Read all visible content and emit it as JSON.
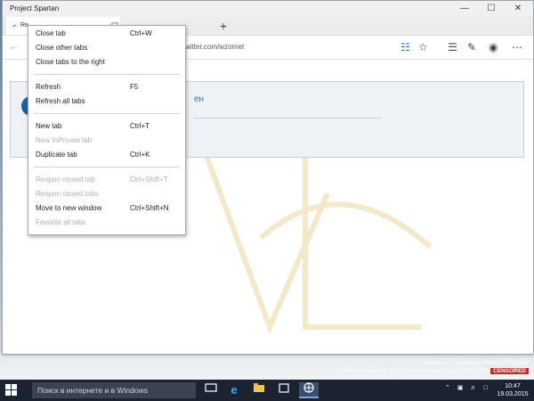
{
  "window": {
    "title": "Project Spartan"
  },
  "tabs": [
    {
      "label": "Re",
      "active": true
    },
    {
      "label": "",
      "active": false
    }
  ],
  "address": {
    "url": "witter.com/wzornet"
  },
  "page": {
    "card_text": "ен"
  },
  "context_menu": {
    "items": [
      {
        "label": "Close tab",
        "shortcut": "Ctrl+W",
        "enabled": true
      },
      {
        "label": "Close other tabs",
        "shortcut": "",
        "enabled": true
      },
      {
        "label": "Close tabs to the right",
        "shortcut": "",
        "enabled": true
      },
      {
        "label": "Refresh",
        "shortcut": "F5",
        "enabled": true
      },
      {
        "label": "Refresh all tabs",
        "shortcut": "",
        "enabled": true
      },
      {
        "label": "New tab",
        "shortcut": "Ctrl+T",
        "enabled": true
      },
      {
        "label": "New InPrivate tab",
        "shortcut": "",
        "enabled": false
      },
      {
        "label": "Duplicate tab",
        "shortcut": "Ctrl+K",
        "enabled": true
      },
      {
        "label": "Reopen closed tab",
        "shortcut": "Ctrl+Shift+T",
        "enabled": false
      },
      {
        "label": "Reopen closed tabs",
        "shortcut": "",
        "enabled": false
      },
      {
        "label": "Move to new window",
        "shortcut": "Ctrl+Shift+N",
        "enabled": true
      },
      {
        "label": "Favorite all tabs",
        "shortcut": "",
        "enabled": false
      }
    ]
  },
  "watermark": {
    "line1": "Windows 10 Enterprise Technical Preview",
    "line2": "Пробная версия. Build 10014.winmain_prs.150305-1855",
    "censored": "CENSORED"
  },
  "taskbar": {
    "search_placeholder": "Поиск в интернете и в Windows",
    "time": "10:47",
    "date": "19.03.2015"
  },
  "colors": {
    "accent": "#1b5fa8",
    "taskbar": "#1b2330",
    "link": "#2a6fb8"
  }
}
